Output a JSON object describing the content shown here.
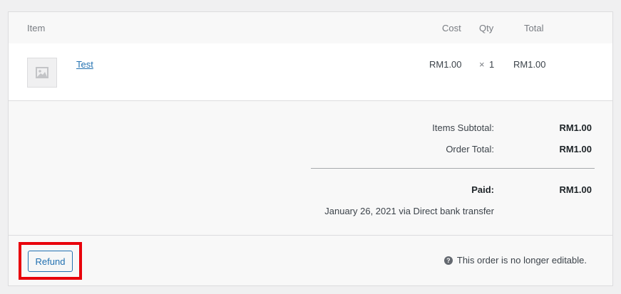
{
  "table": {
    "headers": {
      "item": "Item",
      "cost": "Cost",
      "qty": "Qty",
      "total": "Total"
    },
    "rows": [
      {
        "name": "Test",
        "cost": "RM1.00",
        "qty_symbol": "×",
        "qty": "1",
        "total": "RM1.00"
      }
    ]
  },
  "totals": {
    "items_subtotal_label": "Items Subtotal:",
    "items_subtotal_value": "RM1.00",
    "order_total_label": "Order Total:",
    "order_total_value": "RM1.00",
    "paid_label": "Paid:",
    "paid_value": "RM1.00",
    "paid_note": "January 26, 2021 via Direct bank transfer"
  },
  "footer": {
    "refund_label": "Refund",
    "help_icon_glyph": "?",
    "not_editable_note": "This order is no longer editable."
  },
  "colors": {
    "link": "#2271b1",
    "highlight": "#e8000b"
  }
}
